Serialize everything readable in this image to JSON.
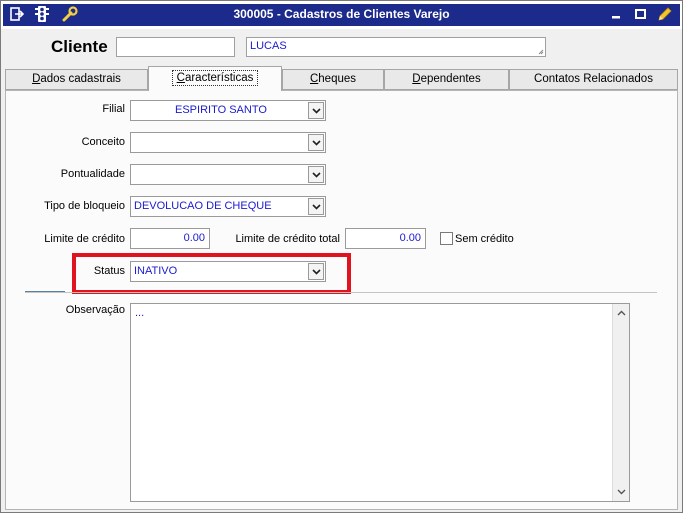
{
  "window": {
    "title": "300005 - Cadastros de Clientes Varejo",
    "title_bar_color": "#1c2a8c",
    "icons": [
      "menu-arrow-icon",
      "traffic-light-icon",
      "wrench-icon",
      "minimize-icon",
      "maximize-icon",
      "pencil-icon"
    ]
  },
  "header": {
    "cliente_label": "Cliente",
    "code_value": "",
    "name_value": "LUCAS"
  },
  "tabs": [
    {
      "label": "Dados cadastrais",
      "underline": "D",
      "rest": "ados cadastrais",
      "active": false
    },
    {
      "label": "Características",
      "underline": "C",
      "rest": "aracterísticas",
      "active": true
    },
    {
      "label": "Cheques",
      "underline": "C",
      "rest": "heques",
      "active": false
    },
    {
      "label": "Dependentes",
      "underline": "D",
      "rest": "ependentes",
      "active": false
    },
    {
      "label": "Contatos Relacionados",
      "underline": "",
      "rest": "Contatos Relacionados",
      "active": false
    }
  ],
  "form": {
    "filial": {
      "label": "Filial",
      "value": "ESPIRITO SANTO"
    },
    "conceito": {
      "label": "Conceito",
      "value": ""
    },
    "pontualidade": {
      "label": "Pontualidade",
      "value": ""
    },
    "tipo_bloqueio": {
      "label": "Tipo de bloqueio",
      "value": "DEVOLUCAO DE CHEQUE"
    },
    "limite_credito": {
      "label": "Limite de crédito",
      "value": "0.00"
    },
    "limite_credito_total": {
      "label": "Limite de crédito total",
      "value": "0.00"
    },
    "sem_credito": {
      "label": "Sem crédito",
      "checked": false
    },
    "status": {
      "label": "Status",
      "value": "INATIVO"
    },
    "observacao": {
      "label": "Observação",
      "value": "..."
    }
  },
  "colors": {
    "value_text": "#1a1ad0",
    "highlight_box": "#e0141e"
  }
}
